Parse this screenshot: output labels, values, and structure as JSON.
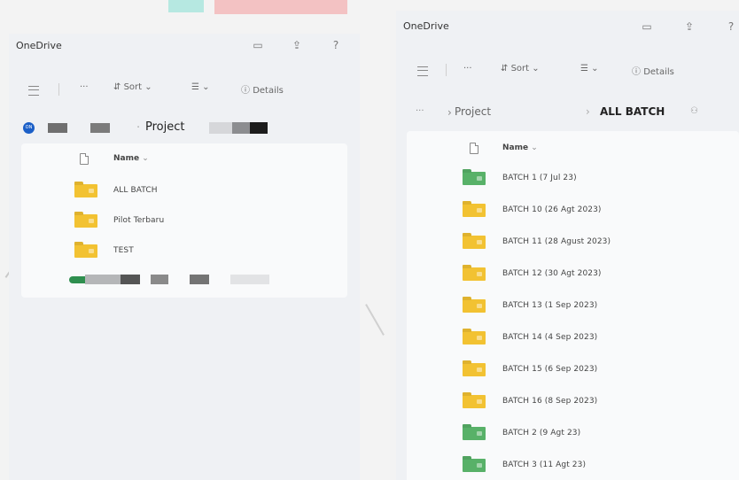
{
  "left": {
    "app_title": "OneDrive",
    "toolbar": {
      "more": "···",
      "sort": "Sort",
      "sort_icon": "⇵",
      "view_icon": "☰",
      "chev": "⌄",
      "details": "Details",
      "details_icon": "ⓘ"
    },
    "breadcrumb": {
      "current": "Project"
    },
    "list": {
      "header_name": "Name",
      "header_chev": "⌄",
      "items": [
        {
          "label": "ALL BATCH",
          "color": "yellow"
        },
        {
          "label": "Pilot Terbaru",
          "color": "yellow"
        },
        {
          "label": "TEST",
          "color": "yellow"
        }
      ]
    }
  },
  "right": {
    "app_title": "OneDrive",
    "toolbar": {
      "more": "···",
      "sort": "Sort",
      "sort_icon": "⇵",
      "view_icon": "☰",
      "chev": "⌄",
      "details": "Details",
      "details_icon": "ⓘ"
    },
    "breadcrumb": {
      "more": "···",
      "parent": "Project",
      "current": "ALL BATCH",
      "sep": "›"
    },
    "list": {
      "header_name": "Name",
      "header_chev": "⌄",
      "items": [
        {
          "label": "BATCH 1 (7 Jul 23)",
          "color": "green"
        },
        {
          "label": "BATCH 10 (26 Agt 2023)",
          "color": "yellow"
        },
        {
          "label": "BATCH 11 (28 Agust 2023)",
          "color": "yellow"
        },
        {
          "label": "BATCH 12 (30 Agt 2023)",
          "color": "yellow"
        },
        {
          "label": "BATCH 13 (1 Sep 2023)",
          "color": "yellow"
        },
        {
          "label": "BATCH 14 (4 Sep 2023)",
          "color": "yellow"
        },
        {
          "label": "BATCH 15 (6 Sep 2023)",
          "color": "yellow"
        },
        {
          "label": "BATCH 16 (8 Sep 2023)",
          "color": "yellow"
        },
        {
          "label": "BATCH 2 (9 Agt 23)",
          "color": "green"
        },
        {
          "label": "BATCH 3 (11 Agt 23)",
          "color": "green"
        }
      ]
    }
  },
  "colors": {
    "folder_yellow": "#f2c232",
    "folder_green": "#58b168",
    "onedrive_blue": "#1b5fc7"
  }
}
